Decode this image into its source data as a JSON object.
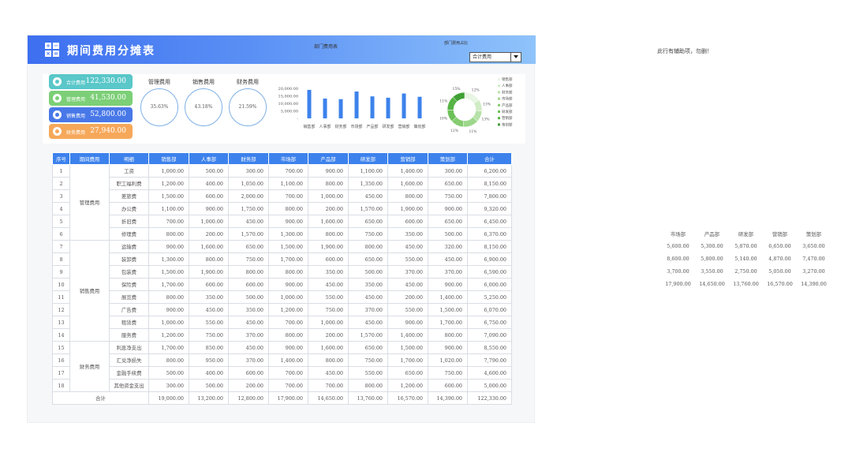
{
  "header": {
    "title": "期间费用分摊表",
    "logo_glyphs": [
      "+",
      "−",
      "×",
      "="
    ],
    "selector_value": "合计费用"
  },
  "note": "此行有辅助项，勿删！",
  "kpis": [
    {
      "label": "合计费用",
      "value": "122,330.00",
      "color": "#5ac7c9"
    },
    {
      "label": "管理费用",
      "value": "41,530.00",
      "color": "#7ccf77"
    },
    {
      "label": "销售费用",
      "value": "52,800.00",
      "color": "#4878e8"
    },
    {
      "label": "财务费用",
      "value": "27,940.00",
      "color": "#f6a85a"
    }
  ],
  "rings": [
    {
      "label": "管理费用",
      "value": "35.63%"
    },
    {
      "label": "销售费用",
      "value": "43.18%"
    },
    {
      "label": "财务费用",
      "value": "21.59%"
    }
  ],
  "chart_data": [
    {
      "type": "bar",
      "title": "部门费用表",
      "categories": [
        "销售部",
        "人事部",
        "财务部",
        "市场部",
        "产品部",
        "研发部",
        "营销部",
        "策划部"
      ],
      "values": [
        19000,
        13200,
        12800,
        17900,
        14650,
        13760,
        16570,
        14390
      ],
      "ylim": [
        0,
        20000
      ],
      "yticks": [
        "20,000.00",
        "15,000.00",
        "10,000.00",
        "5,000.00",
        "-"
      ],
      "color": "#3d82ec"
    },
    {
      "type": "pie",
      "title": "部门费用占比",
      "categories": [
        "销售部",
        "人事部",
        "财务部",
        "市场部",
        "产品部",
        "研发部",
        "营销部",
        "策划部"
      ],
      "values": [
        19000,
        13200,
        12800,
        17900,
        14650,
        13760,
        16570,
        14390
      ],
      "slice_labels": [
        "12%",
        "13%",
        "13%",
        "11%",
        "12%",
        "10%",
        "11%",
        "15%"
      ],
      "colors": [
        "#e9f5e4",
        "#d0ecc6",
        "#b7e2a9",
        "#9dd78b",
        "#86cc70",
        "#6cc057",
        "#57b447",
        "#3fa134"
      ]
    }
  ],
  "table": {
    "headers": [
      "序号",
      "期间费用",
      "明细",
      "销售部",
      "人事部",
      "财务部",
      "市场部",
      "产品部",
      "研发部",
      "营销部",
      "策划部",
      "合计"
    ],
    "groups": [
      {
        "name": "管理费用",
        "rows": [
          [
            "1",
            "工资",
            "1,000.00",
            "500.00",
            "300.00",
            "700.00",
            "900.00",
            "1,100.00",
            "1,400.00",
            "300.00",
            "6,200.00"
          ],
          [
            "2",
            "职工福利费",
            "1,200.00",
            "400.00",
            "1,050.00",
            "1,100.00",
            "800.00",
            "1,350.00",
            "1,600.00",
            "650.00",
            "8,150.00"
          ],
          [
            "3",
            "差旅费",
            "1,500.00",
            "600.00",
            "2,000.00",
            "700.00",
            "1,000.00",
            "450.00",
            "800.00",
            "750.00",
            "7,800.00"
          ],
          [
            "4",
            "办公费",
            "1,100.00",
            "900.00",
            "1,750.00",
            "800.00",
            "200.00",
            "1,570.00",
            "1,900.00",
            "900.00",
            "9,320.00"
          ],
          [
            "5",
            "折旧费",
            "700.00",
            "1,000.00",
            "450.00",
            "900.00",
            "1,600.00",
            "650.00",
            "600.00",
            "650.00",
            "6,450.00"
          ],
          [
            "6",
            "修理费",
            "800.00",
            "200.00",
            "1,570.00",
            "1,300.00",
            "800.00",
            "750.00",
            "350.00",
            "500.00",
            "6,370.00"
          ]
        ]
      },
      {
        "name": "销售费用",
        "rows": [
          [
            "7",
            "运输费",
            "900.00",
            "1,600.00",
            "650.00",
            "1,500.00",
            "1,900.00",
            "800.00",
            "450.00",
            "320.00",
            "8,150.00"
          ],
          [
            "8",
            "装卸费",
            "1,300.00",
            "800.00",
            "750.00",
            "1,700.00",
            "600.00",
            "650.00",
            "550.00",
            "450.00",
            "6,900.00"
          ],
          [
            "9",
            "包装费",
            "1,500.00",
            "1,900.00",
            "800.00",
            "800.00",
            "350.00",
            "500.00",
            "370.00",
            "370.00",
            "6,590.00"
          ],
          [
            "10",
            "保险费",
            "1,700.00",
            "600.00",
            "600.00",
            "900.00",
            "450.00",
            "350.00",
            "450.00",
            "900.00",
            "6,000.00"
          ],
          [
            "11",
            "展览费",
            "800.00",
            "350.00",
            "500.00",
            "1,000.00",
            "550.00",
            "450.00",
            "200.00",
            "1,400.00",
            "5,250.00"
          ],
          [
            "12",
            "广告费",
            "900.00",
            "450.00",
            "350.00",
            "1,200.00",
            "750.00",
            "370.00",
            "550.00",
            "1,500.00",
            "6,070.00"
          ],
          [
            "13",
            "租赁费",
            "1,000.00",
            "550.00",
            "450.00",
            "700.00",
            "1,000.00",
            "450.00",
            "900.00",
            "1,700.00",
            "6,750.00"
          ],
          [
            "14",
            "服务费",
            "1,200.00",
            "750.00",
            "370.00",
            "800.00",
            "200.00",
            "1,570.00",
            "1,400.00",
            "800.00",
            "7,090.00"
          ]
        ]
      },
      {
        "name": "财务费用",
        "rows": [
          [
            "15",
            "利息净支出",
            "1,700.00",
            "850.00",
            "450.00",
            "900.00",
            "1,600.00",
            "650.00",
            "1,500.00",
            "900.00",
            "8,550.00"
          ],
          [
            "16",
            "汇兑净损失",
            "800.00",
            "950.00",
            "370.00",
            "1,400.00",
            "800.00",
            "750.00",
            "1,700.00",
            "1,020.00",
            "7,790.00"
          ],
          [
            "17",
            "金融手续费",
            "500.00",
            "400.00",
            "600.00",
            "700.00",
            "450.00",
            "550.00",
            "650.00",
            "750.00",
            "4,600.00"
          ],
          [
            "18",
            "其他资金支出",
            "300.00",
            "500.00",
            "200.00",
            "700.00",
            "700.00",
            "800.00",
            "1,200.00",
            "600.00",
            "5,000.00"
          ]
        ]
      }
    ],
    "total": [
      "合计",
      "19,000.00",
      "13,200.00",
      "12,800.00",
      "17,900.00",
      "14,650.00",
      "13,760.00",
      "16,570.00",
      "14,390.00",
      "122,330.00"
    ]
  },
  "side_table": {
    "headers": [
      "市场部",
      "产品部",
      "研发部",
      "营销部",
      "策划部"
    ],
    "rows": [
      [
        "5,600.00",
        "5,300.00",
        "5,870.00",
        "6,650.00",
        "3,650.00"
      ],
      [
        "8,600.00",
        "5,800.00",
        "5,140.00",
        "4,870.00",
        "7,470.00"
      ],
      [
        "3,700.00",
        "3,550.00",
        "2,750.00",
        "5,050.00",
        "3,270.00"
      ],
      [
        "17,900.00",
        "14,650.00",
        "13,760.00",
        "16,570.00",
        "14,390.00"
      ]
    ]
  }
}
